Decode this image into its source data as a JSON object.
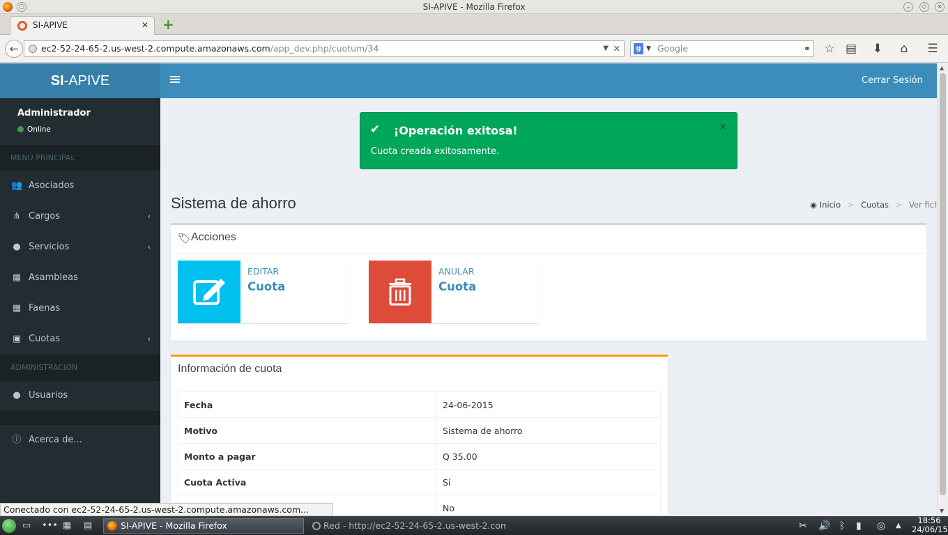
{
  "window": {
    "title": "SI-APIVE - Mozilla Firefox"
  },
  "tab": {
    "title": "SI-APIVE",
    "new_tab": "+"
  },
  "url": {
    "host": "ec2-52-24-65-2.us-west-2.compute.amazonaws.com",
    "path": "/app_dev.php/cuotum/34"
  },
  "search": {
    "placeholder": "Google"
  },
  "app": {
    "logo_bold": "SI",
    "logo_rest": "-APIVE",
    "logout": "Cerrar Sesión"
  },
  "user": {
    "name": "Administrador",
    "status": "Online"
  },
  "sidebar": {
    "section_main": "MENÚ PRINCIPAL",
    "items": [
      {
        "label": "Asociados",
        "icon": "users-icon"
      },
      {
        "label": "Cargos",
        "icon": "sitemap-icon"
      },
      {
        "label": "Servicios",
        "icon": "tint-icon"
      },
      {
        "label": "Asambleas",
        "icon": "calendar-icon"
      },
      {
        "label": "Faenas",
        "icon": "calendar-icon"
      },
      {
        "label": "Cuotas",
        "icon": "money-icon"
      }
    ],
    "section_admin": "ADMINISTRACIÓN",
    "usuarios": "Usuarios",
    "about": "Acerca de..."
  },
  "alert": {
    "title": "¡Operación exitosa!",
    "message": "Cuota creada exitosamente.",
    "close": "×"
  },
  "page": {
    "title": "Sistema de ahorro"
  },
  "breadcrumb": {
    "home": "Inicio",
    "sep": ">",
    "section": "Cuotas",
    "current": "Ver ficha"
  },
  "actions": {
    "title": "Acciones",
    "edit": {
      "label": "EDITAR",
      "target": "Cuota",
      "color": "#00c0ef"
    },
    "void": {
      "label": "ANULAR",
      "target": "Cuota",
      "color": "#dd4b39"
    }
  },
  "info": {
    "title": "Información de cuota",
    "rows": [
      {
        "key": "Fecha",
        "value": "24-06-2015"
      },
      {
        "key": "Motivo",
        "value": "Sistema de ahorro"
      },
      {
        "key": "Monto a pagar",
        "value": "Q 35.00"
      },
      {
        "key": "Cuota Activa",
        "value": "Sí"
      },
      {
        "key": "",
        "value": "No"
      }
    ]
  },
  "statusbar": {
    "text": "Conectado con ec2-52-24-65-2.us-west-2.compute.amazonaws.com..."
  },
  "taskbar": {
    "task_active": "SI-APIVE - Mozilla Firefox",
    "task_other": "Red - http://ec2-52-24-65-2.us-west-2.com",
    "time": "18:56",
    "date": "24/06/15"
  }
}
